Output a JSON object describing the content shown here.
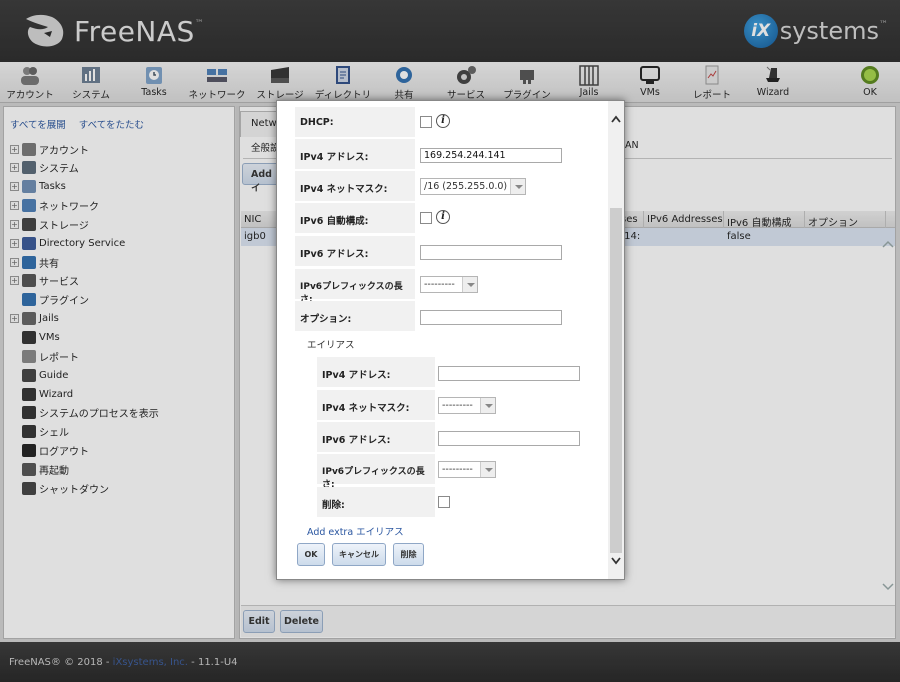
{
  "header": {
    "app_name": "FreeNAS",
    "vendor_ix": "iX",
    "vendor_systems": "systems"
  },
  "toolbar": {
    "items": [
      {
        "label": "アカウント",
        "icon": "users-icon"
      },
      {
        "label": "システム",
        "icon": "system-icon"
      },
      {
        "label": "Tasks",
        "icon": "tasks-icon"
      },
      {
        "label": "ネットワーク",
        "icon": "network-icon"
      },
      {
        "label": "ストレージ",
        "icon": "storage-icon"
      },
      {
        "label": "ディレクトリ",
        "icon": "directory-icon"
      },
      {
        "label": "共有",
        "icon": "share-icon"
      },
      {
        "label": "サービス",
        "icon": "services-icon"
      },
      {
        "label": "プラグイン",
        "icon": "plugins-icon"
      },
      {
        "label": "Jails",
        "icon": "jails-icon"
      },
      {
        "label": "VMs",
        "icon": "vms-icon"
      },
      {
        "label": "レポート",
        "icon": "reports-icon"
      },
      {
        "label": "Wizard",
        "icon": "wizard-icon"
      },
      {
        "label": "OK",
        "icon": "status-ok-icon"
      }
    ]
  },
  "tree": {
    "expand_all": "すべてを展開",
    "collapse_all": "すべてをたたむ",
    "items": [
      {
        "label": "アカウント",
        "expandable": true,
        "color": "#7a7a7a"
      },
      {
        "label": "システム",
        "expandable": true,
        "color": "#5a6a7a"
      },
      {
        "label": "Tasks",
        "expandable": true,
        "color": "#6f8fb5"
      },
      {
        "label": "ネットワーク",
        "expandable": true,
        "color": "#4d7fb8"
      },
      {
        "label": "ストレージ",
        "expandable": true,
        "color": "#444444"
      },
      {
        "label": "Directory Service",
        "expandable": true,
        "color": "#3a5a9a"
      },
      {
        "label": "共有",
        "expandable": true,
        "color": "#2f6fb0"
      },
      {
        "label": "サービス",
        "expandable": true,
        "color": "#555555"
      },
      {
        "label": "プラグイン",
        "expandable": false,
        "color": "#2f6fb0"
      },
      {
        "label": "Jails",
        "expandable": true,
        "color": "#666666"
      },
      {
        "label": "VMs",
        "expandable": false,
        "color": "#333333"
      },
      {
        "label": "レポート",
        "expandable": false,
        "color": "#8a8a8a"
      },
      {
        "label": "Guide",
        "expandable": false,
        "color": "#444444"
      },
      {
        "label": "Wizard",
        "expandable": false,
        "color": "#333333"
      },
      {
        "label": "システムのプロセスを表示",
        "expandable": false,
        "color": "#333333"
      },
      {
        "label": "シェル",
        "expandable": false,
        "color": "#333333"
      },
      {
        "label": "ログアウト",
        "expandable": false,
        "color": "#222222"
      },
      {
        "label": "再起動",
        "expandable": false,
        "color": "#555555"
      },
      {
        "label": "シャットダウン",
        "expandable": false,
        "color": "#444444"
      }
    ]
  },
  "main": {
    "tab_label": "Netwo",
    "subtab_left": "全般設",
    "subtab_right": "AN",
    "add_button": "Add イ",
    "grid": {
      "columns": [
        "NIC",
        "ses",
        "IPv6 Addresses",
        "IPv6 自動構成",
        "オプション"
      ],
      "row": {
        "nic": "igb0",
        "ses": ".14:",
        "ipv6_addresses": "",
        "ipv6_auto": "false",
        "options": ""
      }
    },
    "edit_button": "Edit",
    "delete_button": "Delete"
  },
  "dialog": {
    "fields": {
      "dhcp_label": "DHCP:",
      "ipv4_address_label": "IPv4 アドレス:",
      "ipv4_address_value": "169.254.244.141",
      "ipv4_netmask_label": "IPv4 ネットマスク:",
      "ipv4_netmask_value": "/16 (255.255.0.0)",
      "ipv6_auto_label": "IPv6 自動構成:",
      "ipv6_address_label": "IPv6 アドレス:",
      "ipv6_prefix_label": "IPv6プレフィックスの長さ:",
      "ipv6_prefix_value": "---------",
      "options_label": "オプション:"
    },
    "alias": {
      "section_label": "エイリアス",
      "ipv4_address_label": "IPv4 アドレス:",
      "ipv4_netmask_label": "IPv4 ネットマスク:",
      "ipv4_netmask_value": "---------",
      "ipv6_address_label": "IPv6 アドレス:",
      "ipv6_prefix_label": "IPv6プレフィックスの長さ:",
      "ipv6_prefix_value": "---------",
      "delete_label": "削除:"
    },
    "add_extra": "Add extra エイリアス",
    "ok_button": "OK",
    "cancel_button": "キャンセル",
    "delete_button": "削除"
  },
  "footer": {
    "prefix": "FreeNAS® © 2018 - ",
    "company": "iXsystems, Inc.",
    "version": " - 11.1-U4"
  }
}
